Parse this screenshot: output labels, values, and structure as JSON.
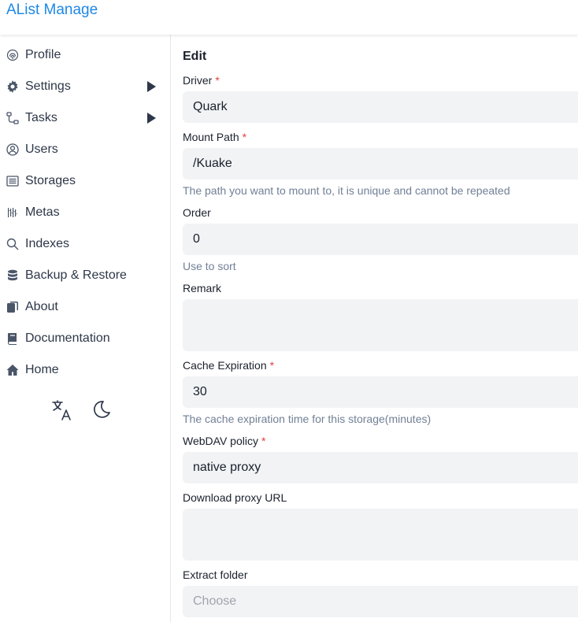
{
  "app": {
    "title": "AList Manage"
  },
  "sidebar": {
    "items": [
      {
        "label": "Profile",
        "icon": "fingerprint-icon"
      },
      {
        "label": "Settings",
        "icon": "gear-icon",
        "expandable": true
      },
      {
        "label": "Tasks",
        "icon": "tasks-icon",
        "expandable": true
      },
      {
        "label": "Users",
        "icon": "user-circle-icon"
      },
      {
        "label": "Storages",
        "icon": "storage-icon"
      },
      {
        "label": "Metas",
        "icon": "metas-icon"
      },
      {
        "label": "Indexes",
        "icon": "search-icon"
      },
      {
        "label": "Backup & Restore",
        "icon": "database-icon"
      },
      {
        "label": "About",
        "icon": "about-icon"
      },
      {
        "label": "Documentation",
        "icon": "book-icon"
      },
      {
        "label": "Home",
        "icon": "home-icon"
      }
    ],
    "tools": [
      "translate-icon",
      "moon-icon"
    ]
  },
  "form": {
    "title": "Edit",
    "driver": {
      "label": "Driver",
      "value": "Quark"
    },
    "mount_path": {
      "label": "Mount Path",
      "value": "/Kuake",
      "help": "The path you want to mount to, it is unique and cannot be repeated"
    },
    "order": {
      "label": "Order",
      "value": "0",
      "help": "Use to sort"
    },
    "remark": {
      "label": "Remark",
      "value": ""
    },
    "cache_expiration": {
      "label": "Cache Expiration",
      "value": "30",
      "help": "The cache expiration time for this storage(minutes)"
    },
    "webdav_policy": {
      "label": "WebDAV policy",
      "value": "native proxy"
    },
    "download_proxy_url": {
      "label": "Download proxy URL",
      "value": ""
    },
    "extract_folder": {
      "label": "Extract folder",
      "placeholder": "Choose"
    },
    "required_mark": "*"
  },
  "colors": {
    "accent": "#1e88e5",
    "required": "#e53e3e",
    "input_bg": "#f1f3f5"
  }
}
